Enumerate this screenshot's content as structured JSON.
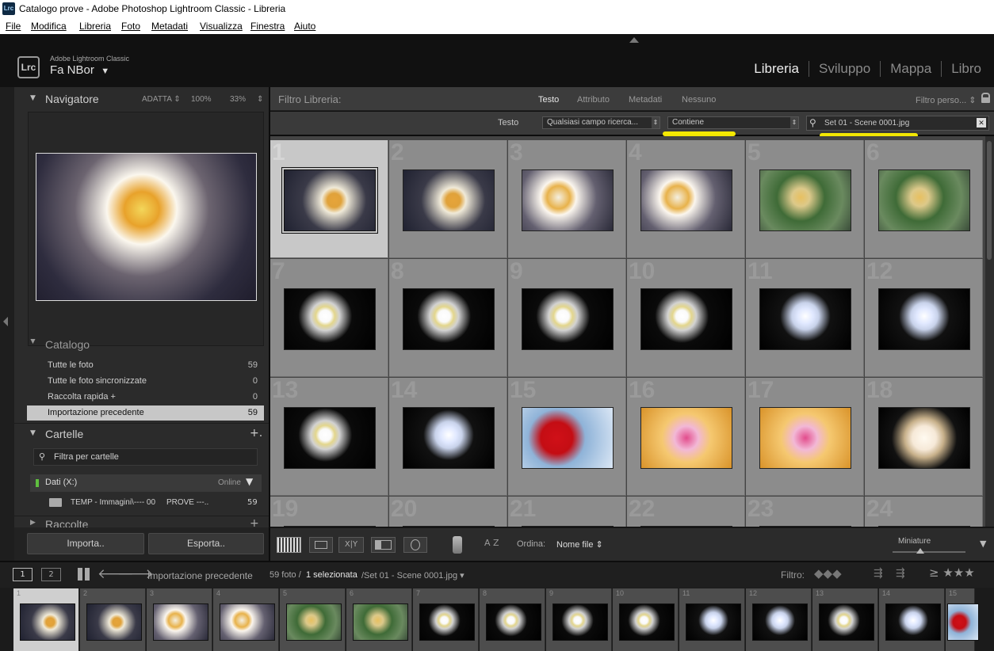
{
  "window": {
    "title": "Catalogo prove - Adobe Photoshop Lightroom Classic - Libreria",
    "app_badge": "Lrc"
  },
  "menu": [
    "File",
    "Modifica",
    "Libreria",
    "Foto",
    "Metadati",
    "Visualizza",
    "Finestra",
    "Aiuto"
  ],
  "identity": {
    "logo": "Lrc",
    "app": "Adobe Lightroom Classic",
    "user": "Fa NBor",
    "user_caret": "▼"
  },
  "modules": [
    "Libreria",
    "Sviluppo",
    "Mappa",
    "Libro"
  ],
  "active_module": "Libreria",
  "navigator": {
    "title": "Navigatore",
    "zoom_fit": "ADATTA ⇕",
    "zoom_100": "100%",
    "zoom_33": "33%",
    "zoom_caret": "⇕"
  },
  "catalog": {
    "title": "Catalogo",
    "items": [
      {
        "label": "Tutte le foto",
        "count": "59"
      },
      {
        "label": "Tutte le foto sincronizzate",
        "count": "0"
      },
      {
        "label": "Raccolta rapida +",
        "count": "0"
      },
      {
        "label": "Importazione precedente",
        "count": "59"
      }
    ]
  },
  "folders": {
    "title": "Cartelle",
    "add": "+.",
    "filter_placeholder": "Filtra per cartelle",
    "volume": "Dati (X:)",
    "volume_status": "Online",
    "folder": "TEMP - Immagini\\---- 00     PROVE ---..",
    "folder_count": "59"
  },
  "collections": {
    "title": "Raccolte",
    "add": "+"
  },
  "buttons": {
    "import": "Importa..",
    "export": "Esporta.."
  },
  "filter": {
    "title": "Filtro Libreria:",
    "tabs": [
      "Testo",
      "Attributo",
      "Metadati",
      "Nessuno"
    ],
    "active_tab": "Testo",
    "preset": "Filtro perso... ⇕",
    "text_label": "Testo",
    "field_dd": "Qualsiasi campo ricerca...",
    "rule_dd": "Contiene",
    "search_value": "Set 01 - Scene 0001.jpg"
  },
  "grid": {
    "cells": [
      {
        "n": "1",
        "style": "p-orange",
        "selected": true
      },
      {
        "n": "2",
        "style": "p-orange"
      },
      {
        "n": "3",
        "style": "p-cream"
      },
      {
        "n": "4",
        "style": "p-cream"
      },
      {
        "n": "5",
        "style": "p-green"
      },
      {
        "n": "6",
        "style": "p-green"
      },
      {
        "n": "7",
        "style": "p-white"
      },
      {
        "n": "8",
        "style": "p-white"
      },
      {
        "n": "9",
        "style": "p-white"
      },
      {
        "n": "10",
        "style": "p-white"
      },
      {
        "n": "11",
        "style": "p-white2"
      },
      {
        "n": "12",
        "style": "p-white2"
      },
      {
        "n": "13",
        "style": "p-white"
      },
      {
        "n": "14",
        "style": "p-white2"
      },
      {
        "n": "15",
        "style": "p-red"
      },
      {
        "n": "16",
        "style": "p-pink"
      },
      {
        "n": "17",
        "style": "p-pink"
      },
      {
        "n": "18",
        "style": "p-blossom"
      },
      {
        "n": "19",
        "style": "p-white"
      },
      {
        "n": "20",
        "style": "p-white"
      },
      {
        "n": "21",
        "style": "p-white"
      },
      {
        "n": "22",
        "style": "p-white"
      },
      {
        "n": "23",
        "style": "p-white"
      },
      {
        "n": "24",
        "style": "p-white"
      }
    ]
  },
  "toolbar": {
    "sort_label": "Ordina:",
    "sort_value": "Nome file ⇕",
    "thumb_label": "Miniature",
    "az": "A Z",
    "xy": "X|Y"
  },
  "filmstrip": {
    "screen1": "1",
    "screen2": "2",
    "source": "Importazione precedente",
    "count": "59 foto /",
    "selected": "1 selezionata",
    "file": "/Set 01 - Scene 0001.jpg ▾",
    "filter_label": "Filtro:",
    "stars": "≥ ★★★",
    "items": [
      {
        "n": "1",
        "style": "p-orange",
        "selected": true
      },
      {
        "n": "2",
        "style": "p-orange"
      },
      {
        "n": "3",
        "style": "p-cream"
      },
      {
        "n": "4",
        "style": "p-cream"
      },
      {
        "n": "5",
        "style": "p-green"
      },
      {
        "n": "6",
        "style": "p-green"
      },
      {
        "n": "7",
        "style": "p-white"
      },
      {
        "n": "8",
        "style": "p-white"
      },
      {
        "n": "9",
        "style": "p-white"
      },
      {
        "n": "10",
        "style": "p-white"
      },
      {
        "n": "11",
        "style": "p-white2"
      },
      {
        "n": "12",
        "style": "p-white2"
      },
      {
        "n": "13",
        "style": "p-white"
      },
      {
        "n": "14",
        "style": "p-white2"
      },
      {
        "n": "15",
        "style": "p-red"
      }
    ]
  }
}
